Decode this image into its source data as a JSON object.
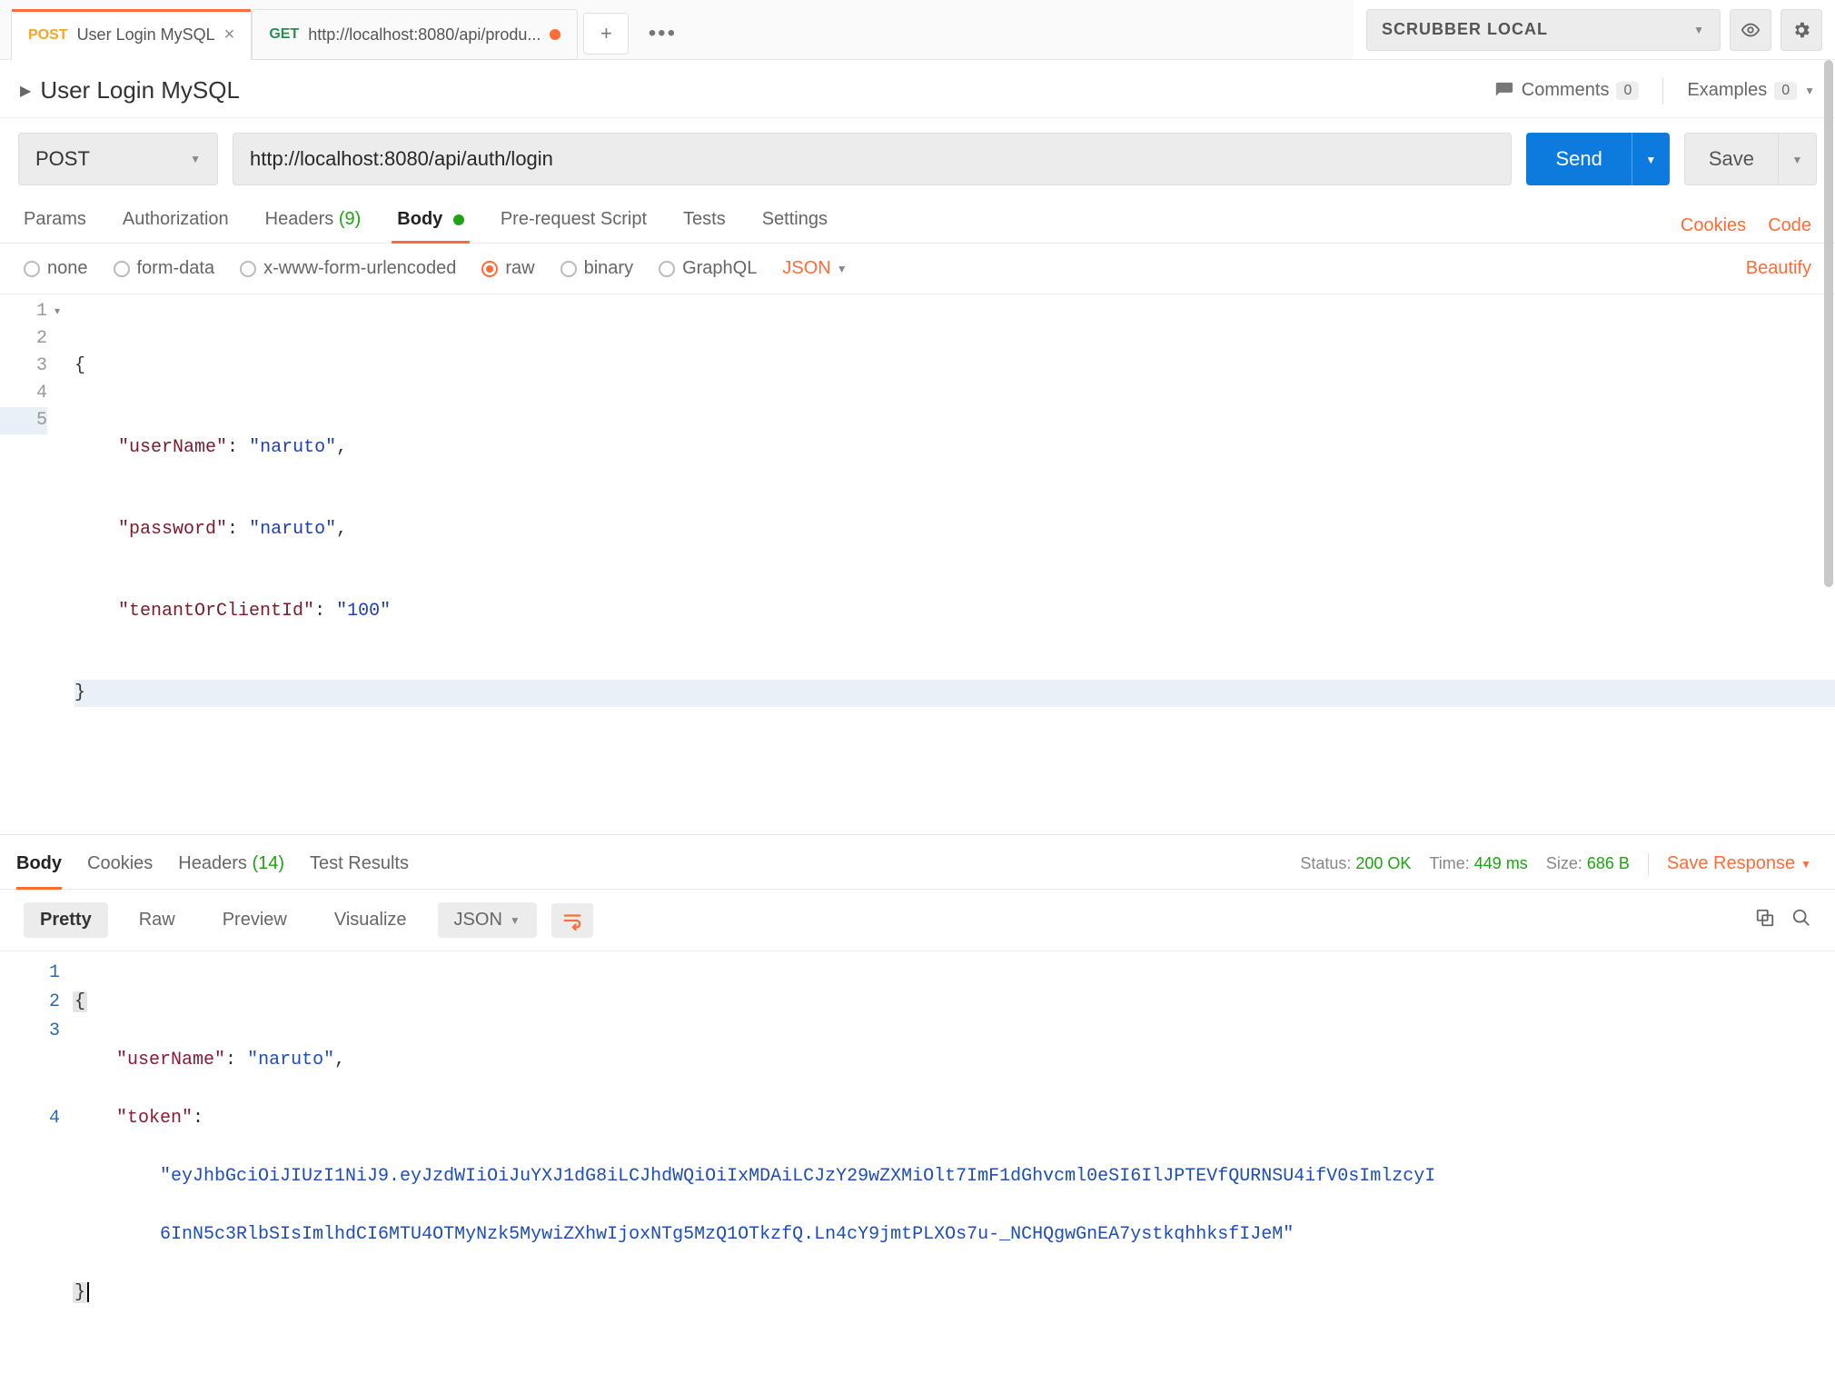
{
  "tabs": [
    {
      "method": "POST",
      "title": "User Login MySQL",
      "active": true
    },
    {
      "method": "GET",
      "title": "http://localhost:8080/api/produ...",
      "dirty": true
    }
  ],
  "environment": {
    "name": "SCRUBBER LOCAL"
  },
  "request": {
    "name": "User Login MySQL",
    "comments_label": "Comments",
    "comments_count": "0",
    "examples_label": "Examples",
    "examples_count": "0",
    "method": "POST",
    "url": "http://localhost:8080/api/auth/login",
    "send_label": "Send",
    "save_label": "Save",
    "tabs": {
      "params": "Params",
      "authorization": "Authorization",
      "headers": "Headers",
      "headers_count": "(9)",
      "body": "Body",
      "prerequest": "Pre-request Script",
      "tests": "Tests",
      "settings": "Settings",
      "cookies": "Cookies",
      "code": "Code"
    },
    "body_types": {
      "none": "none",
      "formdata": "form-data",
      "xwww": "x-www-form-urlencoded",
      "raw": "raw",
      "binary": "binary",
      "graphql": "GraphQL",
      "language": "JSON",
      "beautify": "Beautify"
    },
    "body_lines": {
      "1": {
        "n": "1",
        "text": "{"
      },
      "2": {
        "n": "2",
        "key": "\"userName\"",
        "sep": ": ",
        "val": "\"naruto\"",
        "tail": ","
      },
      "3": {
        "n": "3",
        "key": "\"password\"",
        "sep": ": ",
        "val": "\"naruto\"",
        "tail": ","
      },
      "4": {
        "n": "4",
        "key": "\"tenantOrClientId\"",
        "sep": ": ",
        "val": "\"100\"",
        "tail": ""
      },
      "5": {
        "n": "5",
        "text": "}"
      }
    }
  },
  "response": {
    "tabs": {
      "body": "Body",
      "cookies": "Cookies",
      "headers": "Headers",
      "headers_count": "(14)",
      "test_results": "Test Results"
    },
    "meta": {
      "status_label": "Status:",
      "status_value": "200 OK",
      "time_label": "Time:",
      "time_value": "449 ms",
      "size_label": "Size:",
      "size_value": "686 B",
      "save_response": "Save Response"
    },
    "toolbar": {
      "pretty": "Pretty",
      "raw": "Raw",
      "preview": "Preview",
      "visualize": "Visualize",
      "format": "JSON"
    },
    "body_lines": {
      "1": {
        "n": "1",
        "text": "{"
      },
      "2": {
        "n": "2",
        "key": "\"userName\"",
        "sep": ": ",
        "val": "\"naruto\"",
        "tail": ","
      },
      "3": {
        "n": "3",
        "key": "\"token\"",
        "sep": ":",
        "val_line1": "\"eyJhbGciOiJIUzI1NiJ9.eyJzdWIiOiJuYXJ1dG8iLCJhdWQiOiIxMDAiLCJzY29wZXMiOlt7ImF1dGhvcml0eSI6IlJPTEVfQURNSU4ifV0sImlzcyI",
        "val_line2": "6InN5c3RlbSIsImlhdCI6MTU4OTMyNzk5MywiZXhwIjoxNTg5MzQ1OTkzfQ.Ln4cY9jmtPLXOs7u-_NCHQgwGnEA7ystkqhhksfIJeM\""
      },
      "4": {
        "n": "4",
        "text": "}"
      }
    }
  }
}
